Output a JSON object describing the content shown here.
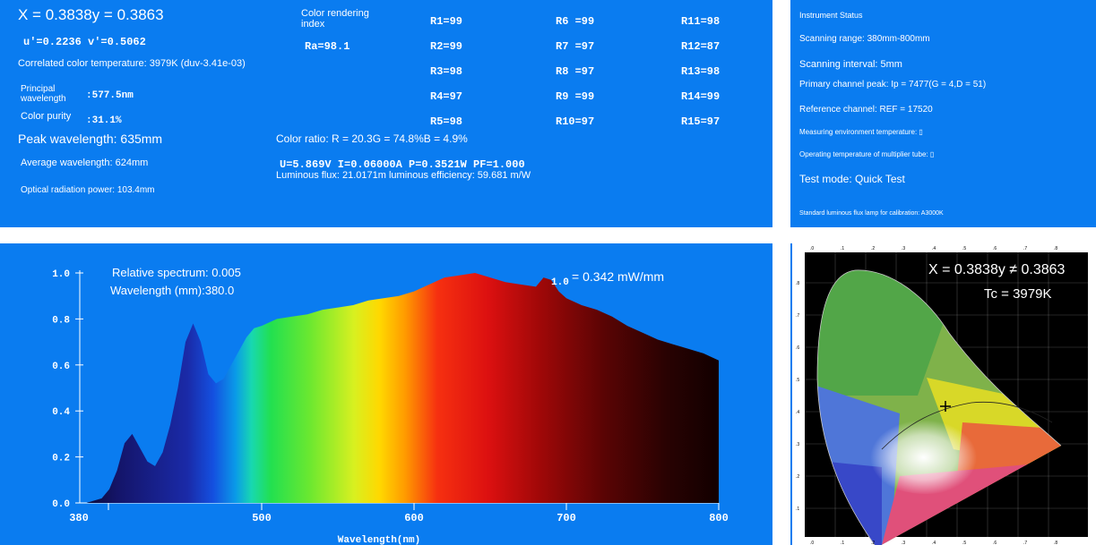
{
  "measurements": {
    "xy": "X = 0.3838y = 0.3863",
    "uv": "u'=0.2236 v'=0.5062",
    "cct": "Correlated color temperature: 3979K (duv-3.41e-03)",
    "principal_wavelength_label": "Principal wavelength",
    "principal_wavelength_value": ":577.5nm",
    "color_purity_label": "Color purity",
    "color_purity_value": ":31.1%",
    "peak_wavelength": "Peak wavelength: 635mm",
    "average_wavelength": "Average wavelength: 624mm",
    "optical_radiation_power": "Optical radiation power: 103.4mm",
    "color_rendering_label": "Color rendering index",
    "ra": "Ra=98.1",
    "color_ratio": "Color ratio: R = 20.3G = 74.8%B = 4.9%",
    "electrical": "U=5.869V I=0.06000A P=0.3521W PF=1.000",
    "luminous_flux": "Luminous flux: 21.0171m luminous efficiency: 59.681 m/W",
    "cri_values": [
      [
        "R1=99",
        "R6 =99",
        "R11=98"
      ],
      [
        "R2=99",
        "R7 =97",
        "R12=87"
      ],
      [
        "R3=98",
        "R8 =97",
        "R13=98"
      ],
      [
        "R4=97",
        "R9 =99",
        "R14=99"
      ],
      [
        "R5=98",
        "R10=97",
        "R15=97"
      ]
    ]
  },
  "status": {
    "title": "Instrument Status",
    "scanning_range": "Scanning range: 380mm-800mm",
    "scanning_interval": "Scanning interval: 5mm",
    "primary_peak": "Primary channel peak: Ip = 7477(G = 4,D = 51)",
    "reference_channel": "Reference channel: REF = 17520",
    "env_temp": "Measuring environment temperature: ▯",
    "multiplier_temp": "Operating temperature of multiplier tube: ▯",
    "test_mode": "Test mode: Quick Test",
    "calibration": "Standard luminous flux lamp for calibration: A3000K"
  },
  "spectrum": {
    "relative_label": "Relative spectrum: 0.005",
    "wavelength_label": "Wavelength (mm):380.0",
    "peak_value_label": "0.342 mW/mm"
  },
  "cie": {
    "xy_label": "X = 0.3838y ≠ 0.3863",
    "tc_label": "Tc = 3979K"
  },
  "chart_data": {
    "type": "area",
    "xlabel": "Wavelength(nm)",
    "ylabel": "",
    "xlim": [
      380,
      800
    ],
    "ylim": [
      0,
      1.0
    ],
    "x_ticks": [
      380,
      500,
      600,
      700,
      800
    ],
    "y_ticks": [
      "0.0",
      "0.2",
      "0.4",
      "0.6",
      "0.8",
      "1.0"
    ],
    "grid": false,
    "annotation": "1.0",
    "x": [
      380,
      385,
      390,
      395,
      400,
      405,
      410,
      415,
      420,
      425,
      430,
      435,
      440,
      445,
      450,
      455,
      460,
      465,
      470,
      475,
      480,
      485,
      490,
      495,
      500,
      510,
      520,
      530,
      540,
      550,
      560,
      570,
      580,
      590,
      600,
      610,
      620,
      630,
      640,
      650,
      660,
      670,
      680,
      685,
      690,
      695,
      700,
      710,
      720,
      730,
      740,
      750,
      760,
      770,
      780,
      790,
      800
    ],
    "y": [
      0.0,
      0.0,
      0.01,
      0.02,
      0.06,
      0.14,
      0.26,
      0.3,
      0.24,
      0.18,
      0.16,
      0.22,
      0.34,
      0.5,
      0.7,
      0.78,
      0.7,
      0.56,
      0.52,
      0.54,
      0.6,
      0.66,
      0.72,
      0.76,
      0.77,
      0.8,
      0.81,
      0.82,
      0.84,
      0.85,
      0.86,
      0.88,
      0.89,
      0.9,
      0.92,
      0.95,
      0.98,
      0.99,
      1.0,
      0.98,
      0.96,
      0.95,
      0.94,
      0.98,
      0.97,
      0.92,
      0.89,
      0.86,
      0.84,
      0.81,
      0.77,
      0.74,
      0.71,
      0.69,
      0.67,
      0.65,
      0.62
    ]
  }
}
